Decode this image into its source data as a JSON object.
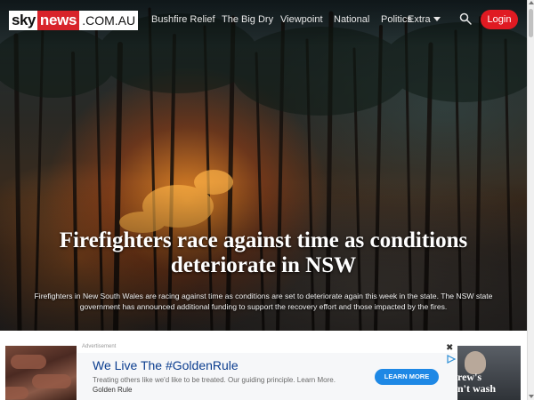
{
  "brand": {
    "sky": "sky",
    "news": "news",
    "domain": ".COM.AU"
  },
  "nav": {
    "items": [
      "Bushfire Relief",
      "The Big Dry",
      "Viewpoint",
      "National",
      "Politics",
      "Extra"
    ],
    "search_icon": "search-icon",
    "login_label": "Login"
  },
  "hero": {
    "headline_line1": "Firefighters race against time as conditions",
    "headline_line2": "deteriorate in NSW",
    "summary_line1": "Firefighters in New South Wales are racing against time as conditions are set to deteriorate again this week in the state. The NSW state",
    "summary_line2": "government has announced additional funding to support the recovery effort and those impacted by the fires."
  },
  "ad": {
    "label": "Advertisement",
    "close": "✖",
    "title": "We Live The #GoldenRule",
    "text": "Treating others like we'd like to be treated. Our guiding principle. Learn More.",
    "brand": "Golden Rule",
    "cta": "LEARN MORE"
  },
  "thumb_right": {
    "line1": "rew's",
    "line2": "n't wash"
  },
  "colors": {
    "accent": "#e01a22",
    "brand_red": "#d8232a",
    "ad_title": "#0b3d8f",
    "cta": "#1e88e5"
  }
}
